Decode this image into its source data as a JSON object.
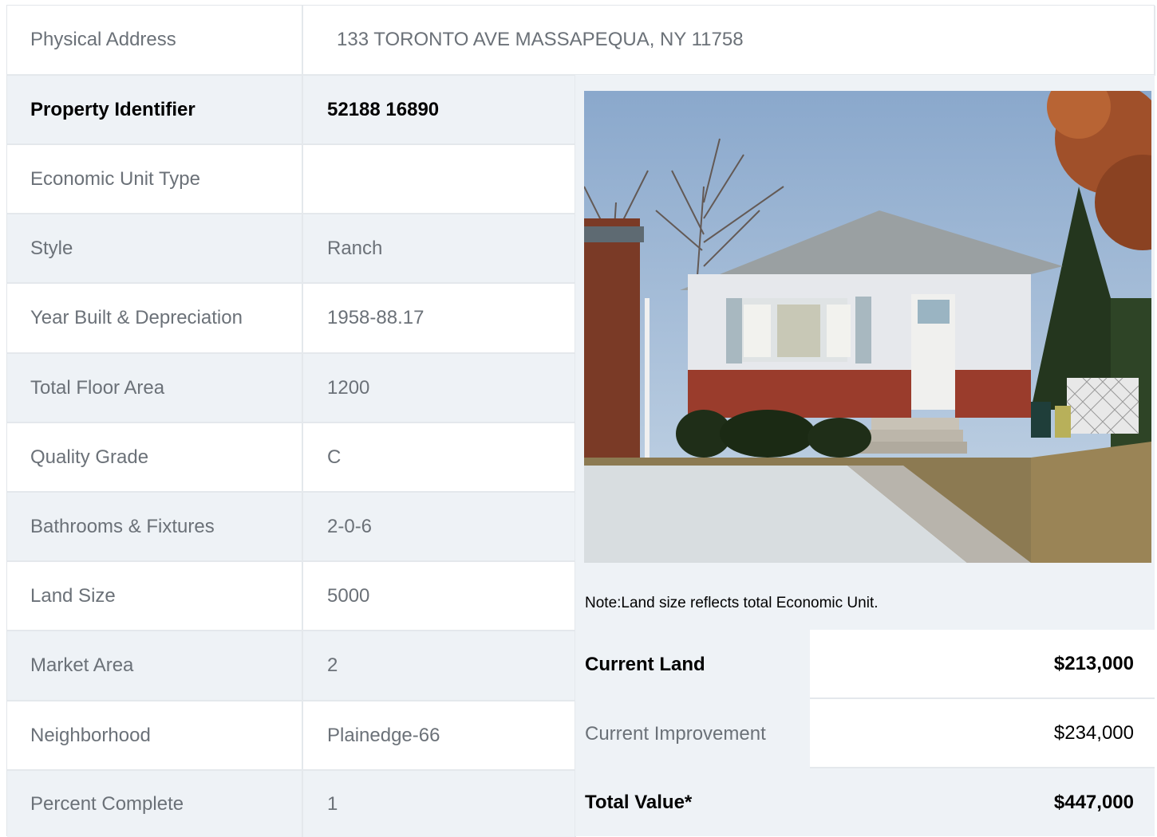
{
  "address": {
    "label": "Physical Address",
    "value": "133  TORONTO AVE  MASSAPEQUA, NY  11758"
  },
  "rows": [
    {
      "label": "Property Identifier",
      "value": "52188  16890"
    },
    {
      "label": "Economic Unit Type",
      "value": ""
    },
    {
      "label": "Style",
      "value": "Ranch"
    },
    {
      "label": "Year Built & Depreciation",
      "value": "1958-88.17"
    },
    {
      "label": "Total Floor Area",
      "value": "1200"
    },
    {
      "label": "Quality Grade",
      "value": "C"
    },
    {
      "label": "Bathrooms & Fixtures",
      "value": "2-0-6"
    },
    {
      "label": "Land Size",
      "value": "5000"
    },
    {
      "label": "Market Area",
      "value": "2"
    },
    {
      "label": "Neighborhood",
      "value": "Plainedge-66"
    },
    {
      "label": "Percent Complete",
      "value": "1"
    }
  ],
  "note": "Note:Land size reflects total Economic Unit.",
  "valuation": [
    {
      "label": "Current Land",
      "value": "$213,000"
    },
    {
      "label": "Current Improvement",
      "value": "$234,000"
    },
    {
      "label": "Total Value*",
      "value": "$447,000"
    }
  ]
}
